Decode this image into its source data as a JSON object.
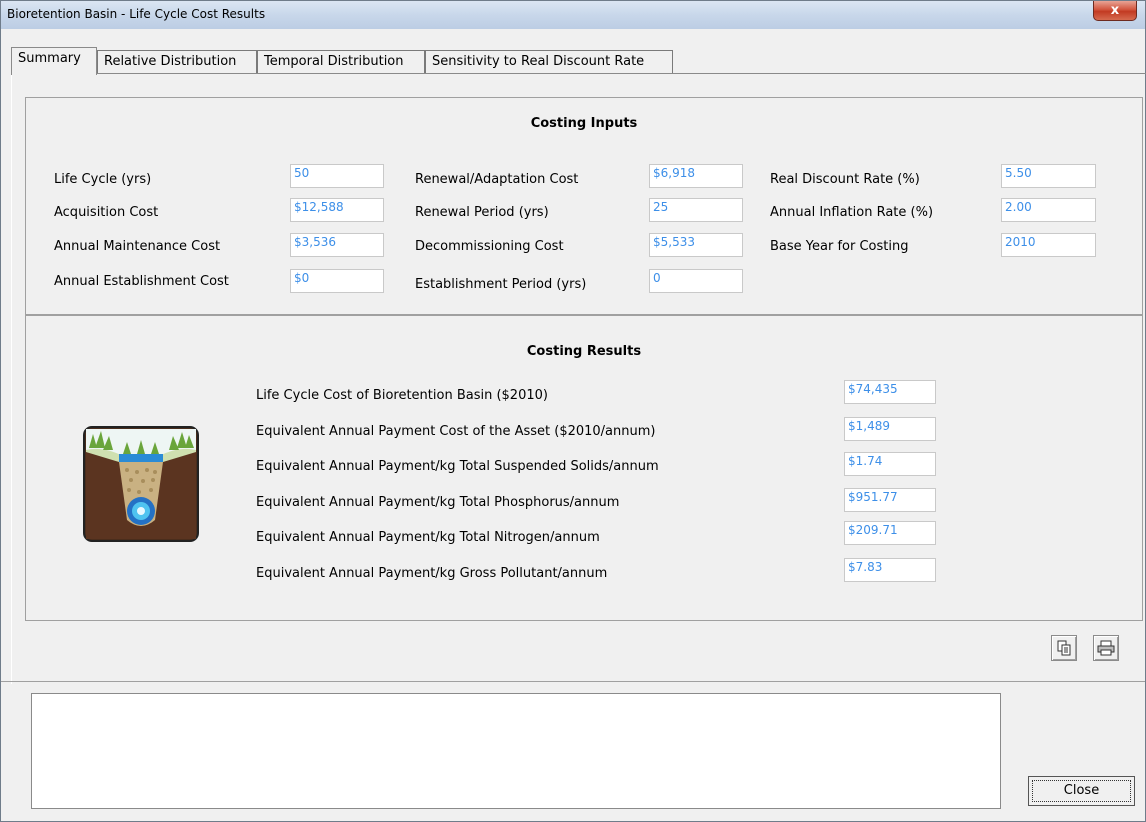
{
  "window": {
    "title": "Bioretention Basin - Life Cycle Cost Results",
    "close_glyph": "x"
  },
  "tabs": [
    {
      "label": "Summary"
    },
    {
      "label": "Relative Distribution"
    },
    {
      "label": "Temporal Distribution"
    },
    {
      "label": "Sensitivity to Real Discount Rate"
    }
  ],
  "inputs": {
    "title": "Costing Inputs",
    "col1": [
      {
        "label": "Life Cycle (yrs)",
        "value": "50"
      },
      {
        "label": "Acquisition Cost",
        "value": "$12,588"
      },
      {
        "label": "Annual Maintenance Cost",
        "value": "$3,536"
      },
      {
        "label": "Annual Establishment Cost",
        "value": "$0"
      }
    ],
    "col2": [
      {
        "label": "Renewal/Adaptation Cost",
        "value": "$6,918"
      },
      {
        "label": "Renewal Period (yrs)",
        "value": "25"
      },
      {
        "label": "Decommissioning Cost",
        "value": "$5,533"
      },
      {
        "label": "Establishment Period (yrs)",
        "value": "0"
      }
    ],
    "col3": [
      {
        "label": "Real Discount Rate (%)",
        "value": "5.50"
      },
      {
        "label": "Annual Inflation Rate (%)",
        "value": "2.00"
      },
      {
        "label": "Base Year for Costing",
        "value": "2010"
      }
    ]
  },
  "results": {
    "title": "Costing Results",
    "rows": [
      {
        "label": "Life Cycle Cost of Bioretention Basin ($2010)",
        "value": "$74,435"
      },
      {
        "label": "Equivalent Annual Payment Cost of the Asset ($2010/annum)",
        "value": "$1,489"
      },
      {
        "label": "Equivalent Annual Payment/kg Total Suspended Solids/annum",
        "value": "$1.74"
      },
      {
        "label": "Equivalent Annual Payment/kg Total Phosphorus/annum",
        "value": "$951.77"
      },
      {
        "label": "Equivalent Annual Payment/kg Total Nitrogen/annum",
        "value": "$209.71"
      },
      {
        "label": "Equivalent Annual Payment/kg Gross Pollutant/annum",
        "value": "$7.83"
      }
    ]
  },
  "toolbar": {
    "copy_icon": "copy-icon",
    "print_icon": "printer-icon"
  },
  "notes": {
    "value": ""
  },
  "buttons": {
    "close_label": "Close"
  }
}
